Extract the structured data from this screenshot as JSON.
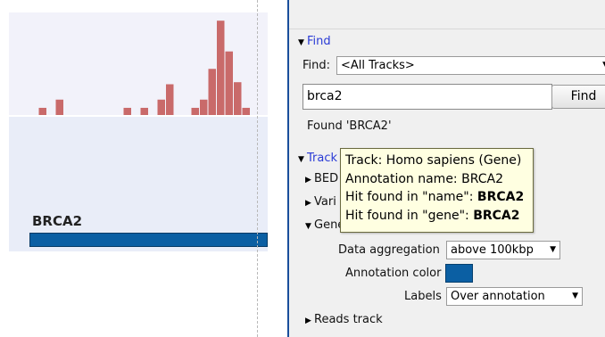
{
  "track_view": {
    "histogram_color": "#c96a6a",
    "histogram_values": [
      0,
      0.07,
      0,
      0.15,
      0,
      0,
      0,
      0,
      0,
      0,
      0,
      0.07,
      0,
      0.07,
      0,
      0.15,
      0.3,
      0,
      0,
      0.07,
      0.15,
      0.45,
      0.92,
      0.62,
      0.32,
      0.07,
      0
    ],
    "gene_label": "BRCA2",
    "gene_color": "#0b5fa3"
  },
  "find": {
    "section_label": "Find",
    "scope_label": "Find:",
    "scope_value": "<All Tracks>",
    "query": "brca2",
    "button_label": "Find",
    "result": "Found 'BRCA2'"
  },
  "tracks": {
    "section_label": "Track",
    "items": [
      {
        "label": "BED"
      },
      {
        "label": "Vari"
      },
      {
        "label": "Gene track"
      }
    ],
    "aggregation_label": "Data aggregation",
    "aggregation_value": "above 100kbp",
    "annotation_color_label": "Annotation color",
    "annotation_color": "#0b5fa3",
    "labels_label": "Labels",
    "labels_value": "Over annotation",
    "reads_label": "Reads track"
  },
  "tooltip": {
    "line1": "Track: Homo sapiens (Gene)",
    "line2": "Annotation name: BRCA2",
    "line3_prefix": "Hit found in \"name\": ",
    "line3_value": "BRCA2",
    "line4_prefix": "Hit found in \"gene\": ",
    "line4_value": "BRCA2"
  }
}
